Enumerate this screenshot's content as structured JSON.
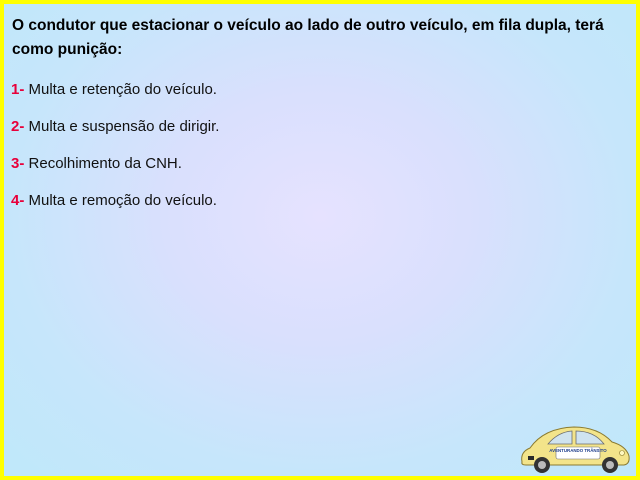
{
  "question": "O condutor que estacionar o veículo ao lado de outro veículo, em fila dupla, terá como punição:",
  "options": [
    {
      "number": "1-",
      "text": "Multa e retenção do veículo."
    },
    {
      "number": "2-",
      "text": "Multa e suspensão de dirigir."
    },
    {
      "number": "3-",
      "text": "Recolhimento da CNH."
    },
    {
      "number": "4-",
      "text": "Multa e remoção do veículo."
    }
  ],
  "logo": {
    "text": "AVENTURANDO TRÂNSITO",
    "icon": "beetle-car-icon"
  },
  "colors": {
    "border": "#ffff00",
    "number": "#e8003a",
    "car": "#f3e48a"
  }
}
